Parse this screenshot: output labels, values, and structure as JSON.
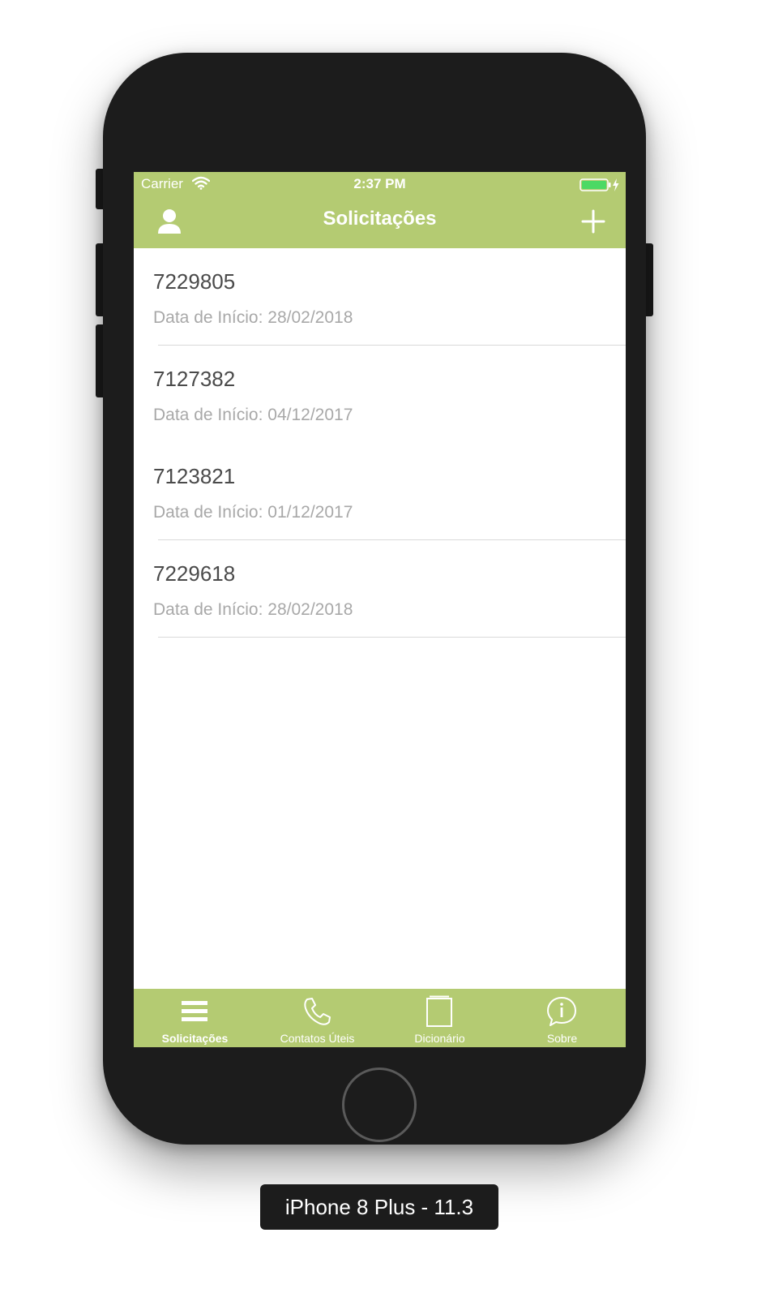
{
  "status_bar": {
    "carrier": "Carrier",
    "time": "2:37 PM"
  },
  "navbar": {
    "title": "Solicitações"
  },
  "list": {
    "items": [
      {
        "number": "7229805",
        "start_label": "Data de Início:",
        "start_date": "28/02/2018"
      },
      {
        "number": "7127382",
        "start_label": "Data de Início:",
        "start_date": "04/12/2017"
      },
      {
        "number": "7123821",
        "start_label": "Data de Início:",
        "start_date": "01/12/2017"
      },
      {
        "number": "7229618",
        "start_label": "Data de Início:",
        "start_date": "28/02/2018"
      }
    ]
  },
  "tabbar": {
    "tabs": [
      {
        "label": "Solicitações",
        "icon": "list-icon"
      },
      {
        "label": "Contatos Úteis",
        "icon": "phone-icon"
      },
      {
        "label": "Dicionário",
        "icon": "book-icon"
      },
      {
        "label": "Sobre",
        "icon": "info-icon"
      }
    ]
  },
  "device": {
    "label": "iPhone 8 Plus - 11.3"
  },
  "colors": {
    "brand_green": "#b4cb72",
    "phone_body": "#1c1c1c"
  }
}
